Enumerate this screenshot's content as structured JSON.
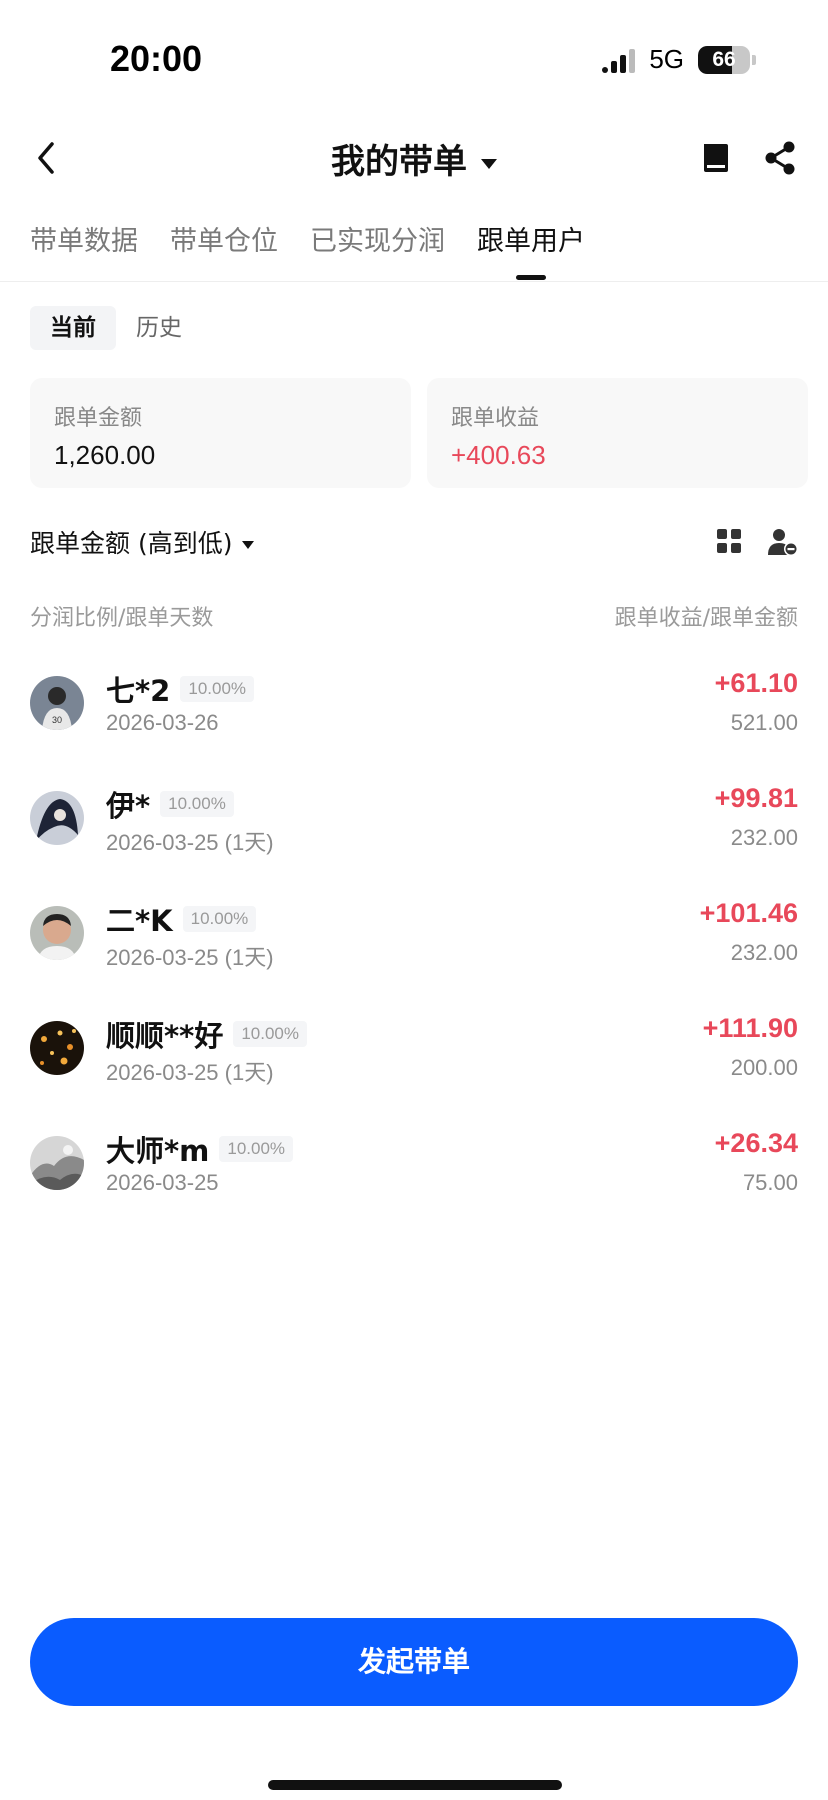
{
  "status_bar": {
    "time": "20:00",
    "network": "5G",
    "battery": "66",
    "battery_level_percent": 66
  },
  "header": {
    "title": "我的带单",
    "icons": [
      "back-icon",
      "caret-down-icon",
      "book-icon",
      "share-icon"
    ]
  },
  "tabs": [
    {
      "label": "带单数据",
      "active": false
    },
    {
      "label": "带单仓位",
      "active": false
    },
    {
      "label": "已实现分润",
      "active": false
    },
    {
      "label": "跟单用户",
      "active": true
    }
  ],
  "subtabs": [
    {
      "label": "当前",
      "active": true
    },
    {
      "label": "历史",
      "active": false
    }
  ],
  "summary": {
    "follow_amount_label": "跟单金额",
    "follow_amount_value": "1,260.00",
    "follow_profit_label": "跟单收益",
    "follow_profit_value": "+400.63"
  },
  "sort": {
    "label": "跟单金额 (高到低)",
    "icons": [
      "grid-view-icon",
      "user-remove-icon"
    ]
  },
  "columns": {
    "left": "分润比例/跟单天数",
    "right": "跟单收益/跟单金额"
  },
  "followers": [
    {
      "name": "七*2",
      "ratio": "10.00%",
      "date": "2026-03-26",
      "profit": "+61.10",
      "amount": "521.00",
      "avatar_color": "#5a6470"
    },
    {
      "name": "伊*",
      "ratio": "10.00%",
      "date": "2026-03-25 (1天)",
      "profit": "+99.81",
      "amount": "232.00",
      "avatar_color": "#3c4a66"
    },
    {
      "name": "二*K",
      "ratio": "10.00%",
      "date": "2026-03-25 (1天)",
      "profit": "+101.46",
      "amount": "232.00",
      "avatar_color": "#c99a86"
    },
    {
      "name": "顺顺**好",
      "ratio": "10.00%",
      "date": "2026-03-25 (1天)",
      "profit": "+111.90",
      "amount": "200.00",
      "avatar_color": "#3a2a14"
    },
    {
      "name": "大师*m",
      "ratio": "10.00%",
      "date": "2026-03-25",
      "profit": "+26.34",
      "amount": "75.00",
      "avatar_color": "#9a9a9a"
    }
  ],
  "cta": {
    "label": "发起带单",
    "color": "#0a5cff"
  },
  "colors": {
    "positive": "#e8485a",
    "text_primary": "#111111",
    "text_secondary": "#8a8a8a"
  }
}
